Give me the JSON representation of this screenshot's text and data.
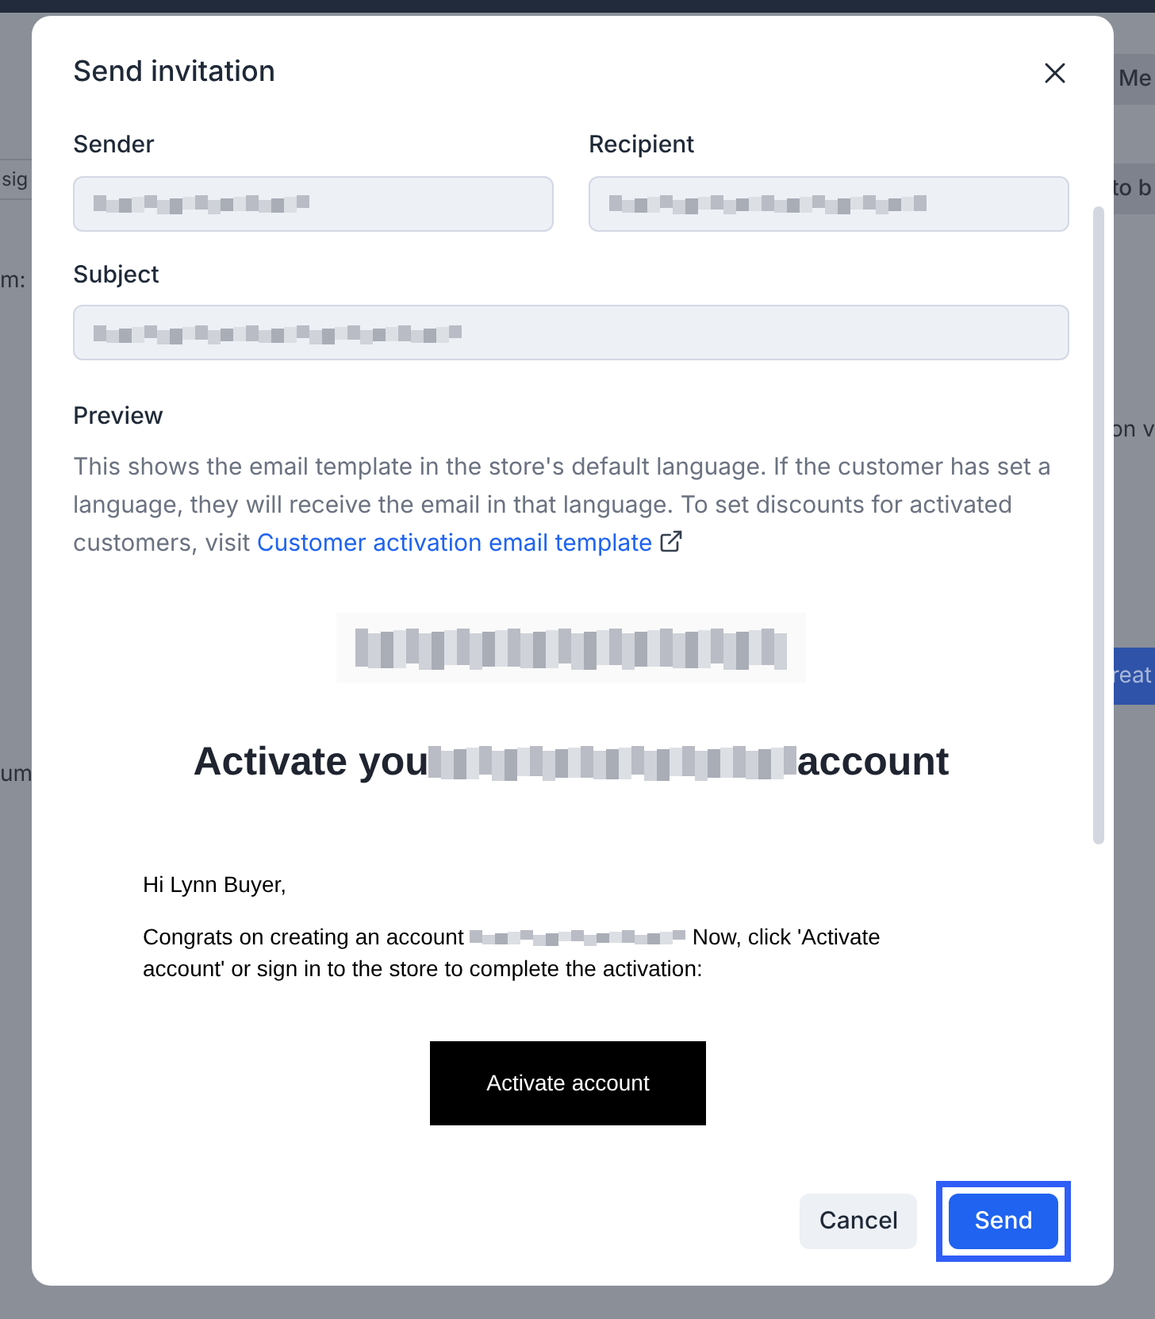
{
  "background": {
    "fragments": [
      {
        "text": "Me",
        "kind": "button"
      },
      {
        "text": "sig",
        "kind": "field"
      },
      {
        "text": "to b",
        "kind": "button"
      },
      {
        "text": "m:",
        "kind": "text"
      },
      {
        "text": "on v",
        "kind": "text"
      },
      {
        "text": "reat",
        "kind": "primary"
      },
      {
        "text": "um",
        "kind": "text"
      }
    ]
  },
  "dialog": {
    "title": "Send invitation",
    "fields": [
      {
        "label": "Sender"
      },
      {
        "label": "Recipient"
      },
      {
        "label": "Subject"
      }
    ],
    "preview": {
      "label": "Preview",
      "description": "This shows the email template in the store's default language. If the customer has set a language, they will receive the email in that language. To set discounts for activated customers, visit",
      "link": "Customer activation email template"
    },
    "email": {
      "heading_start": "Activate you",
      "heading_end": "account",
      "greeting": "Hi Lynn Buyer,",
      "body_start": "Congrats on creating an account",
      "body_middle": "Now, click 'Activate",
      "body_end": "account' or sign in to the store to complete the activation:",
      "button": "Activate account"
    },
    "buttons": {
      "cancel": "Cancel",
      "send": "Send",
      "send_highlighted": true
    }
  }
}
